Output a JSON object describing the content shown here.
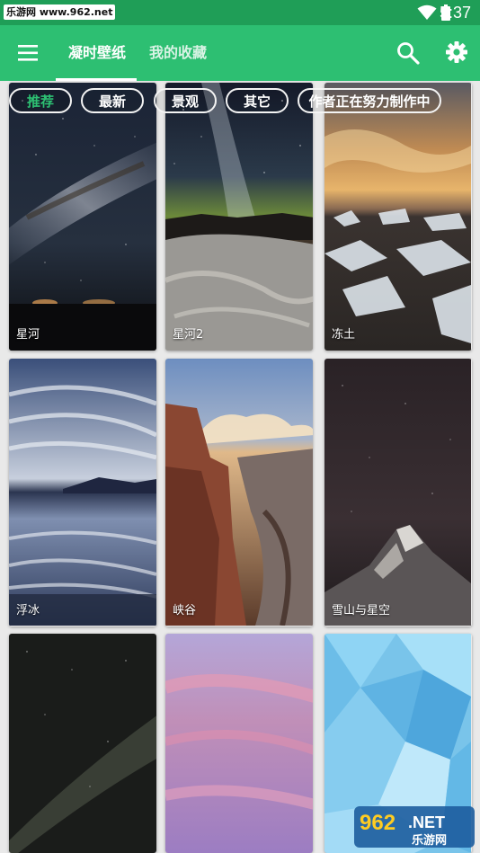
{
  "status_bar": {
    "watermark": "乐游网 www.962.net",
    "time": "5:37"
  },
  "app_bar": {
    "tabs": [
      {
        "label": "凝时壁纸",
        "selected": true
      },
      {
        "label": "我的收藏",
        "selected": false
      }
    ],
    "icons": [
      "menu-icon",
      "search-icon",
      "gear-icon"
    ],
    "accent_color": "#2dbf72",
    "status_color": "#1f9e57"
  },
  "filters": [
    {
      "label": "推荐",
      "selected": true
    },
    {
      "label": "最新",
      "selected": false
    },
    {
      "label": "景观",
      "selected": false
    },
    {
      "label": "其它",
      "selected": false
    },
    {
      "label": "作者正在努力制作中",
      "selected": false
    }
  ],
  "wallpapers": [
    {
      "title": "星河"
    },
    {
      "title": "星河2"
    },
    {
      "title": "冻土"
    },
    {
      "title": "浮冰"
    },
    {
      "title": "峡谷"
    },
    {
      "title": "雪山与星空"
    },
    {
      "title": ""
    },
    {
      "title": ""
    },
    {
      "title": ""
    }
  ],
  "watermark_badge": {
    "number": "962",
    "suffix": ".NET",
    "text": "乐游网"
  }
}
